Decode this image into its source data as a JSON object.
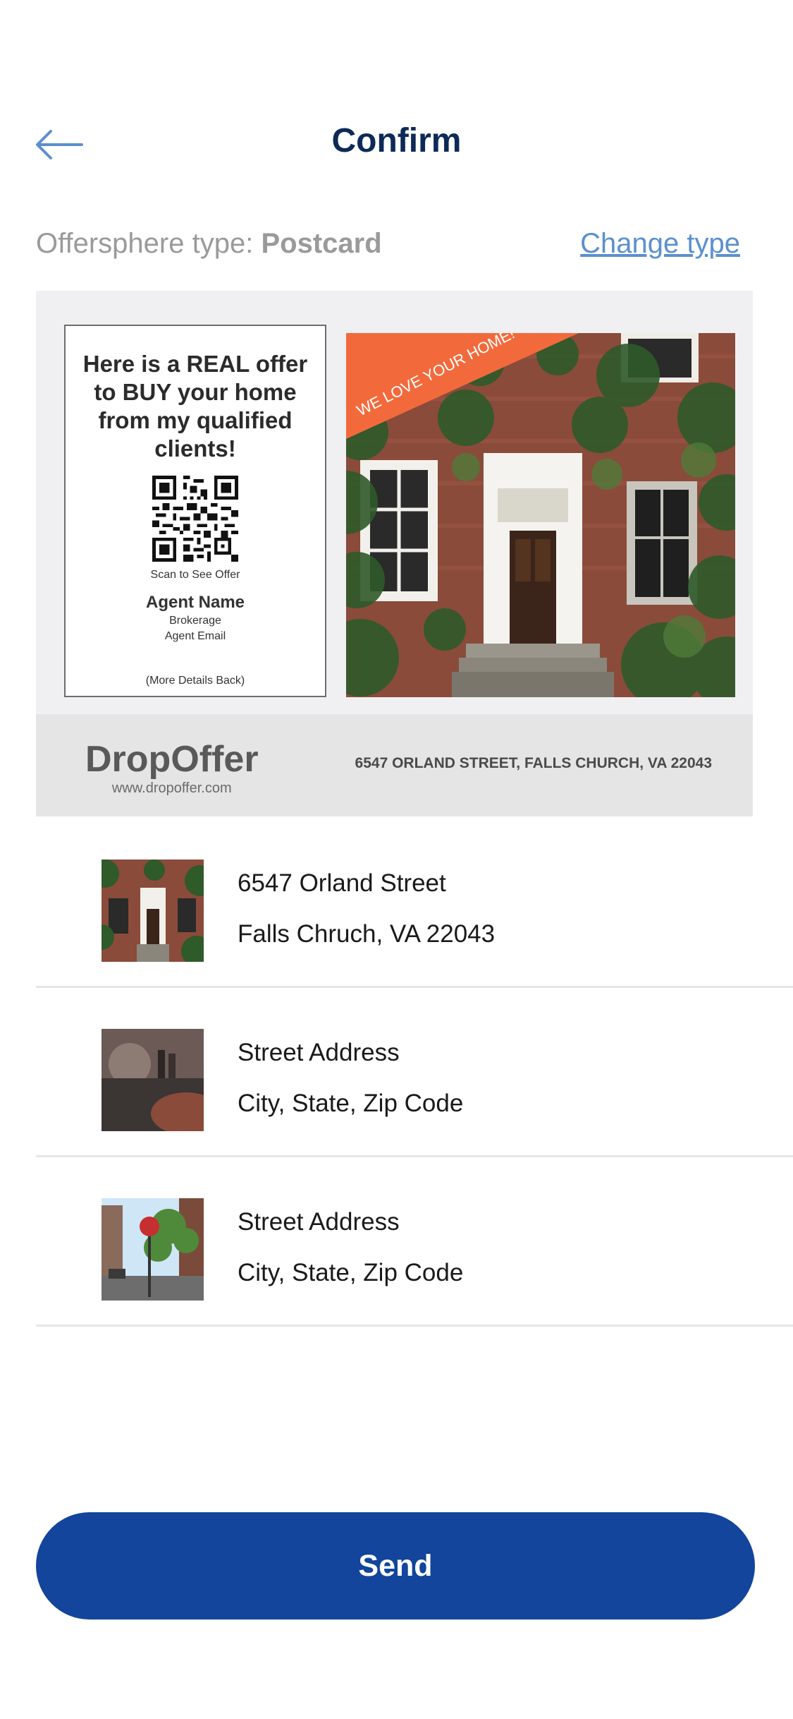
{
  "header": {
    "title": "Confirm",
    "back_icon": "arrow-left-icon"
  },
  "type_row": {
    "label": "Offersphere type:",
    "value": "Postcard",
    "change_link": "Change type"
  },
  "postcard": {
    "headline": "Here is a REAL offer to BUY your home from my qualified clients!",
    "scan_text": "Scan to See Offer",
    "agent_name": "Agent Name",
    "brokerage": "Brokerage",
    "agent_email": "Agent Email",
    "more_details": "(More Details Back)",
    "banner": "WE LOVE YOUR HOME!",
    "logo_text": "DropOffer",
    "logo_url": "www.dropoffer.com",
    "address": "6547 ORLAND STREET, FALLS CHURCH, VA 22043",
    "accent_color": "#f26a3c"
  },
  "addresses": [
    {
      "line1": "6547 Orland Street",
      "line2": "Falls Chruch, VA 22043"
    },
    {
      "line1": "Street Address",
      "line2": "City, State, Zip Code"
    },
    {
      "line1": "Street Address",
      "line2": "City, State, Zip Code"
    }
  ],
  "send_button": "Send",
  "colors": {
    "primary": "#12459b",
    "title": "#0d2a57",
    "link": "#5b90cf"
  }
}
